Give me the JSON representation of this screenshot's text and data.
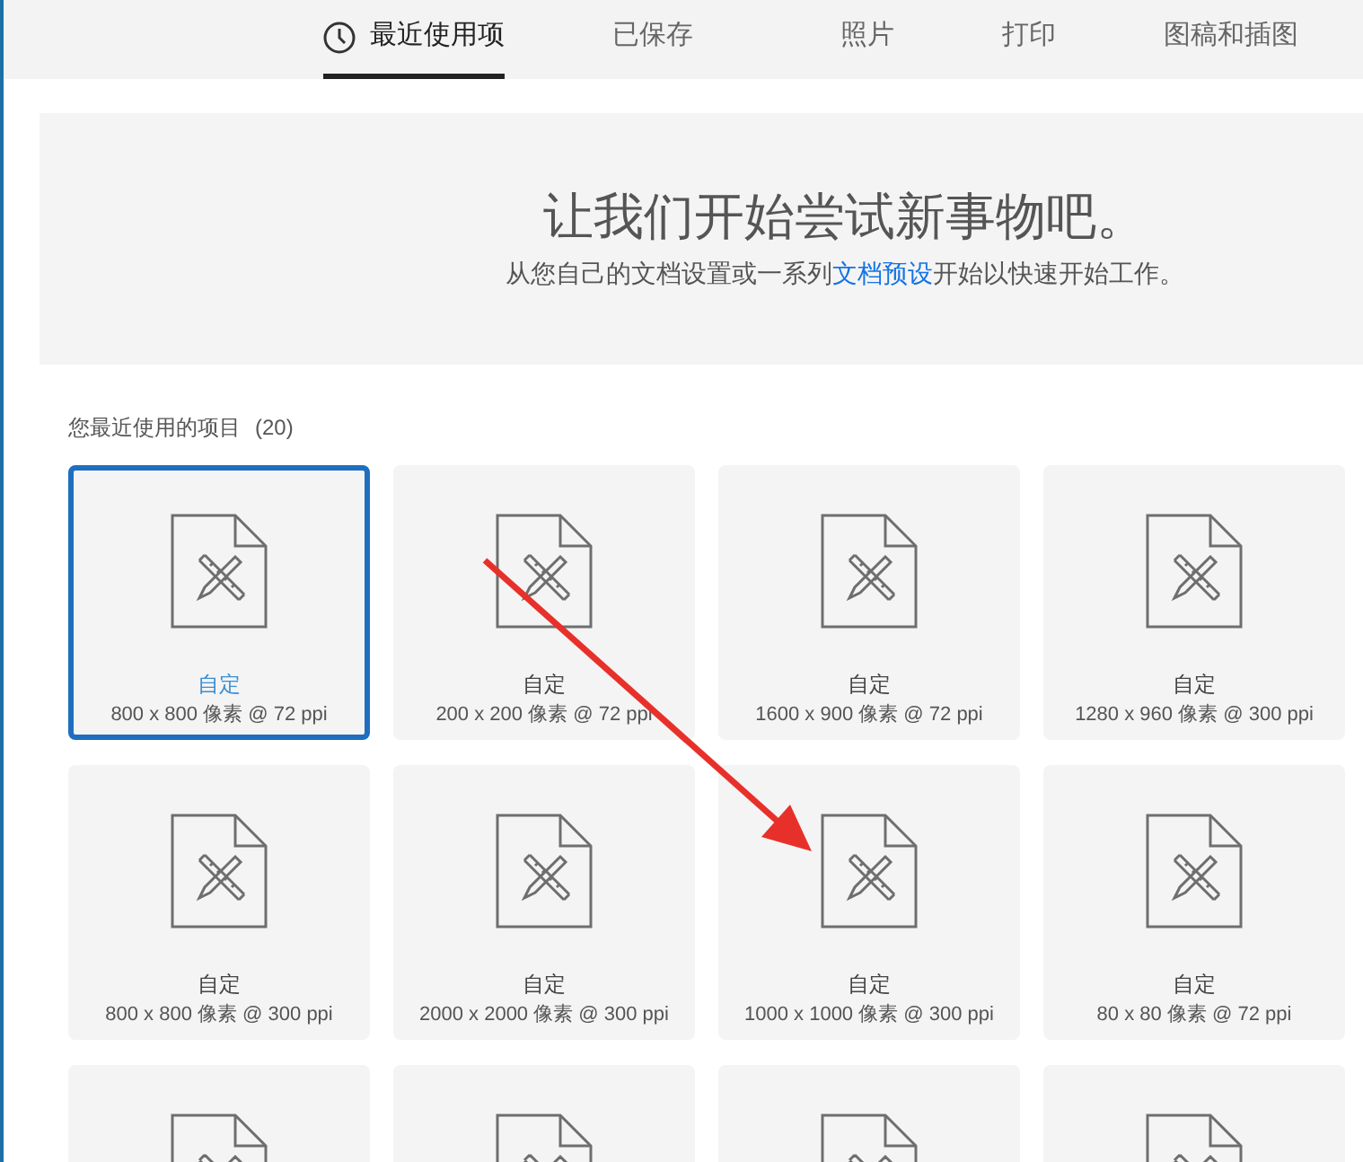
{
  "tabs": [
    {
      "label": "最近使用项",
      "selected": true,
      "kind": "recent"
    },
    {
      "label": "已保存",
      "selected": false
    },
    {
      "label": "照片",
      "selected": false
    },
    {
      "label": "打印",
      "selected": false
    },
    {
      "label": "图稿和插图",
      "selected": false
    }
  ],
  "hero": {
    "title": "让我们开始尝试新事物吧。",
    "subtitle_before": "从您自己的文档设置或一系列",
    "link": "文档预设",
    "subtitle_after": "开始以快速开始工作。"
  },
  "section": {
    "label": "您最近使用的项目",
    "count": "(20)"
  },
  "items": [
    {
      "name": "自定",
      "size": "800 x 800 像素 @ 72 ppi",
      "selected": true
    },
    {
      "name": "自定",
      "size": "200 x 200 像素 @ 72 ppi",
      "selected": false
    },
    {
      "name": "自定",
      "size": "1600 x 900 像素 @ 72 ppi",
      "selected": false
    },
    {
      "name": "自定",
      "size": "1280 x 960 像素 @ 300 ppi",
      "selected": false
    },
    {
      "name": "自定",
      "size": "800 x 800 像素 @ 300 ppi",
      "selected": false
    },
    {
      "name": "自定",
      "size": "2000 x 2000 像素 @ 300 ppi",
      "selected": false
    },
    {
      "name": "自定",
      "size": "1000 x 1000 像素 @ 300 ppi",
      "selected": false
    },
    {
      "name": "自定",
      "size": "80 x 80 像素 @ 72 ppi",
      "selected": false
    },
    {
      "selected": false
    },
    {
      "selected": false
    },
    {
      "selected": false
    },
    {
      "selected": false
    }
  ],
  "annotation": {
    "kind": "arrow"
  }
}
